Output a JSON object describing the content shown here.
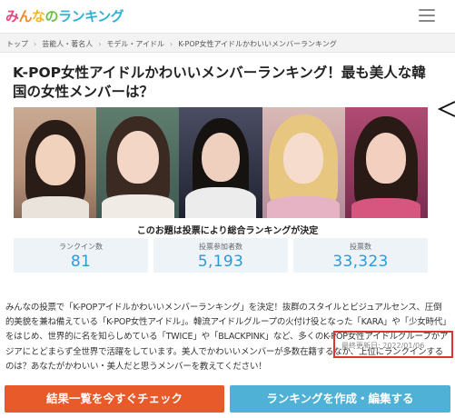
{
  "header": {
    "logo_parts": [
      "み",
      "ん",
      "な",
      "の",
      "ランキング"
    ],
    "menu_icon": "hamburger-menu-icon"
  },
  "breadcrumb": {
    "items": [
      "トップ",
      "芸能人・著名人",
      "モデル・アイドル",
      "K-POP女性アイドルかわいいメンバーランキング"
    ],
    "separator": "›"
  },
  "page": {
    "title": "K-POP女性アイドルかわいいメンバーランキング！最も美人な韓国の女性メンバーは？",
    "caption": "このお題は投票により総合ランキングが決定"
  },
  "stats": [
    {
      "label": "ランクイン数",
      "value": "81"
    },
    {
      "label": "投票参加者数",
      "value": "5,193"
    },
    {
      "label": "投票数",
      "value": "33,323"
    }
  ],
  "description": "みんなの投票で「K-POPアイドルかわいいメンバーランキング」を決定！抜群のスタイルとビジュアルセンス、圧倒的美貌を兼ね備えている「K-POP女性アイドル」。韓流アイドルグループの火付け役となった「KARA」や「少女時代」をはじめ、世界的に名を知らしめている「TWICE」や「BLACKPINK」など、多くのK-POP女性アイドルグループがアジアにとどまらず全世界で活躍をしています。美人でかわいいメンバーが多数在籍するなか、上位にランクインするのは？あなたがかわいい・美人だと思うメンバーを教えてください！",
  "updated": "最終更新日: 2022/01/06",
  "buttons": {
    "results": "結果一覧を今すぐチェック",
    "create": "ランキングを作成・編集する"
  },
  "colors": {
    "accent_blue": "#2b9bd8",
    "button_orange": "#e85a2a",
    "button_blue": "#4fb1d6",
    "highlight_red": "#e23333"
  }
}
